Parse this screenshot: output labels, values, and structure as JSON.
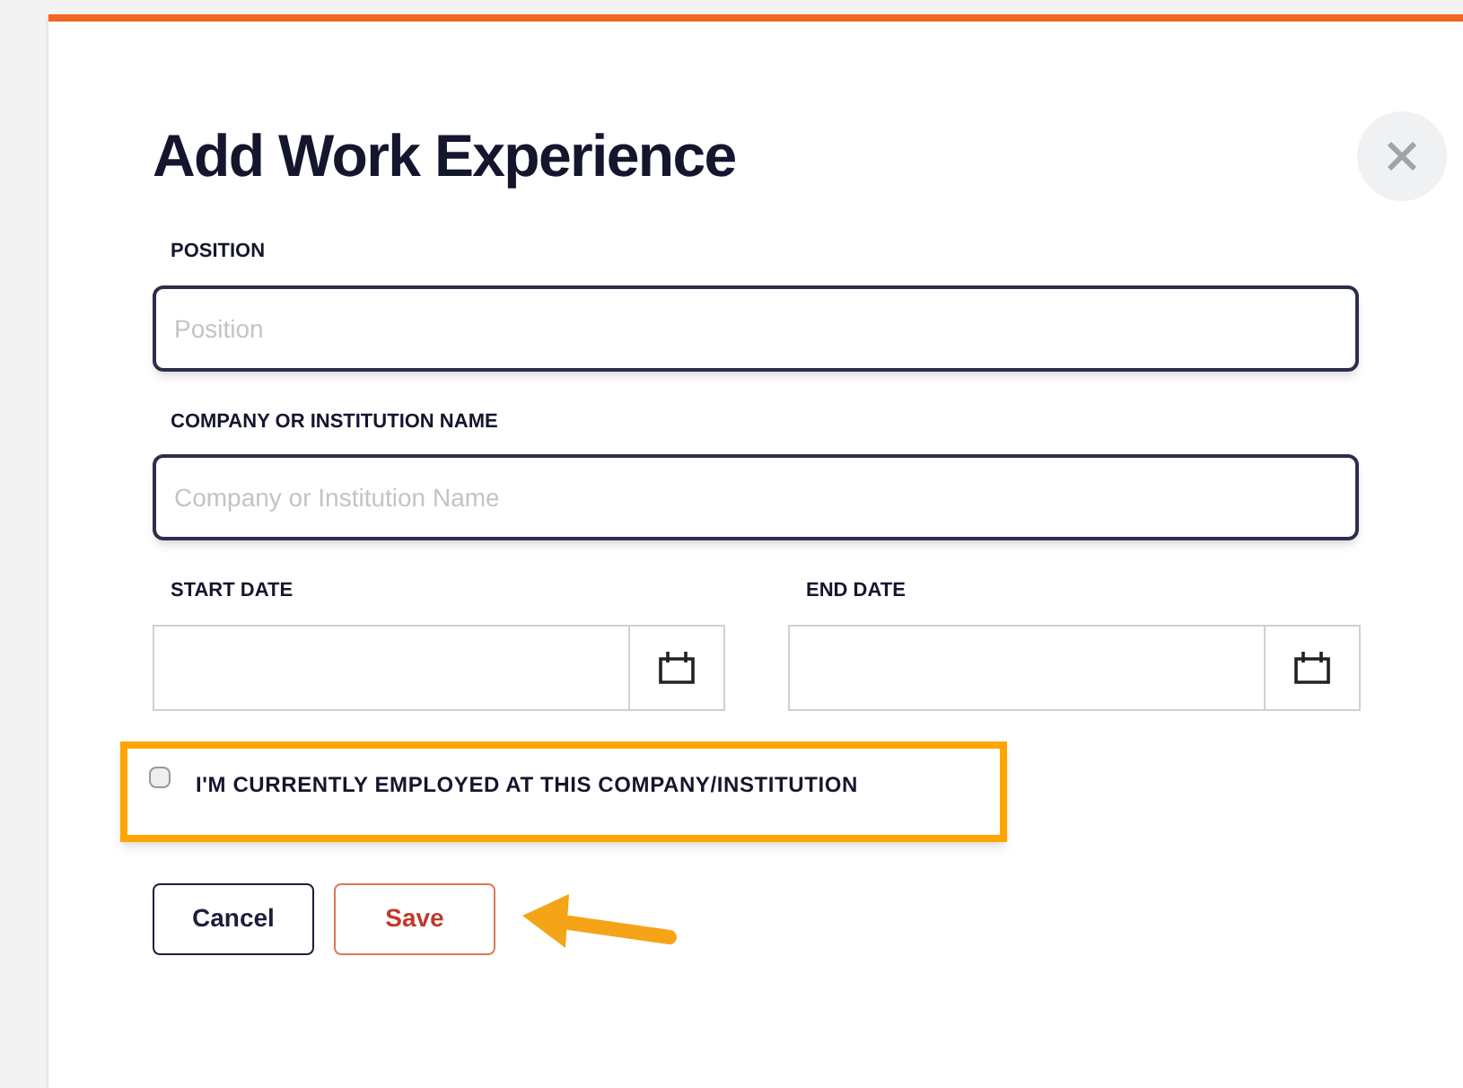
{
  "dialog": {
    "title": "Add Work Experience",
    "text_fields": [
      {
        "label": "POSITION",
        "placeholder": "Position"
      },
      {
        "label": "COMPANY OR INSTITUTION NAME",
        "placeholder": "Company or Institution Name"
      }
    ],
    "date_fields": [
      {
        "label": "START DATE"
      },
      {
        "label": "END DATE"
      }
    ],
    "checkbox": {
      "label": "I'M CURRENTLY EMPLOYED AT THIS COMPANY/INSTITUTION",
      "checked": false
    },
    "buttons": [
      {
        "label": "Cancel",
        "kind": "secondary"
      },
      {
        "label": "Save",
        "kind": "primary"
      }
    ]
  }
}
